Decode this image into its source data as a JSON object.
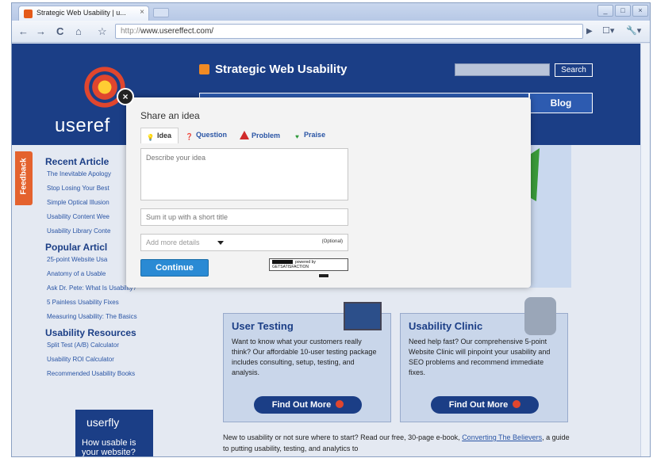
{
  "browser": {
    "tab_title": "Strategic Web Usability | u...",
    "tab_close": "×",
    "url_scheme": "http://",
    "url_host": "www.usereffect.com/",
    "nav": {
      "back": "←",
      "forward": "→",
      "reload": "C",
      "home": "⌂",
      "star": "☆",
      "go": "▶",
      "page_menu": "☐▾",
      "tools_menu": "🔧▾"
    },
    "window_controls": [
      "_",
      "□",
      "×"
    ]
  },
  "site": {
    "logo_text": "useref",
    "title": "Strategic Web Usability",
    "search_button": "Search",
    "nav_blog": "Blog",
    "feedback_tab": "Feedback",
    "sidebar": {
      "recent_heading": "Recent Article",
      "recent": [
        "The Inevitable Apology",
        "Stop Losing Your Best",
        "Simple Optical Illusion",
        "Usability Content Wee",
        "Usability Library Conte"
      ],
      "popular_heading": "Popular Articl",
      "popular": [
        "25-point Website Usa",
        "Anatomy of a Usable",
        "Ask Dr. Pete: What Is Usability?",
        "5 Painless Usability Fixes",
        "Measuring Usability: The Basics"
      ],
      "resources_heading": "Usability Resources",
      "resources": [
        "Split Test (A/B) Calculator",
        "Usability ROI Calculator",
        "Recommended Usability Books"
      ]
    },
    "userfly": {
      "brand": "userfly",
      "tagline": "How usable is your website?"
    },
    "services": [
      {
        "title": "User Testing",
        "body": "Want to know what your customers really think? Our affordable 10-user testing package includes consulting, setup, testing, and analysis.",
        "button": "Find Out More"
      },
      {
        "title": "Usability Clinic",
        "body": "Need help fast? Our comprehensive 5-point Website Clinic will pinpoint your usability and SEO problems and recommend immediate fixes.",
        "button": "Find Out More"
      }
    ],
    "intro_before": "New to usability or not sure where to start? Read our free, 30-page e-book,",
    "intro_link": "Converting The Believers",
    "intro_after": ", a guide to putting usability, testing, and analytics to"
  },
  "modal": {
    "close": "×",
    "title": "Share an idea",
    "tabs": [
      {
        "label": "Idea",
        "icon": "lightbulb-icon",
        "glyph": "💡"
      },
      {
        "label": "Question",
        "icon": "question-icon",
        "glyph": "❓"
      },
      {
        "label": "Problem",
        "icon": "warning-icon",
        "glyph": ""
      },
      {
        "label": "Praise",
        "icon": "heart-icon",
        "glyph": "♥"
      }
    ],
    "description_placeholder": "Describe your idea",
    "summary_placeholder": "Sum it up with a short title",
    "details_label": "Add more details",
    "details_optional": "(Optional)",
    "continue_button": "Continue",
    "powered_by_line1": "powered by",
    "powered_by_line2": "GETSATISFACTION"
  },
  "colors": {
    "accent": "#2a8ad4",
    "site_blue": "#1b3e86",
    "brand_orange": "#e4622e"
  }
}
